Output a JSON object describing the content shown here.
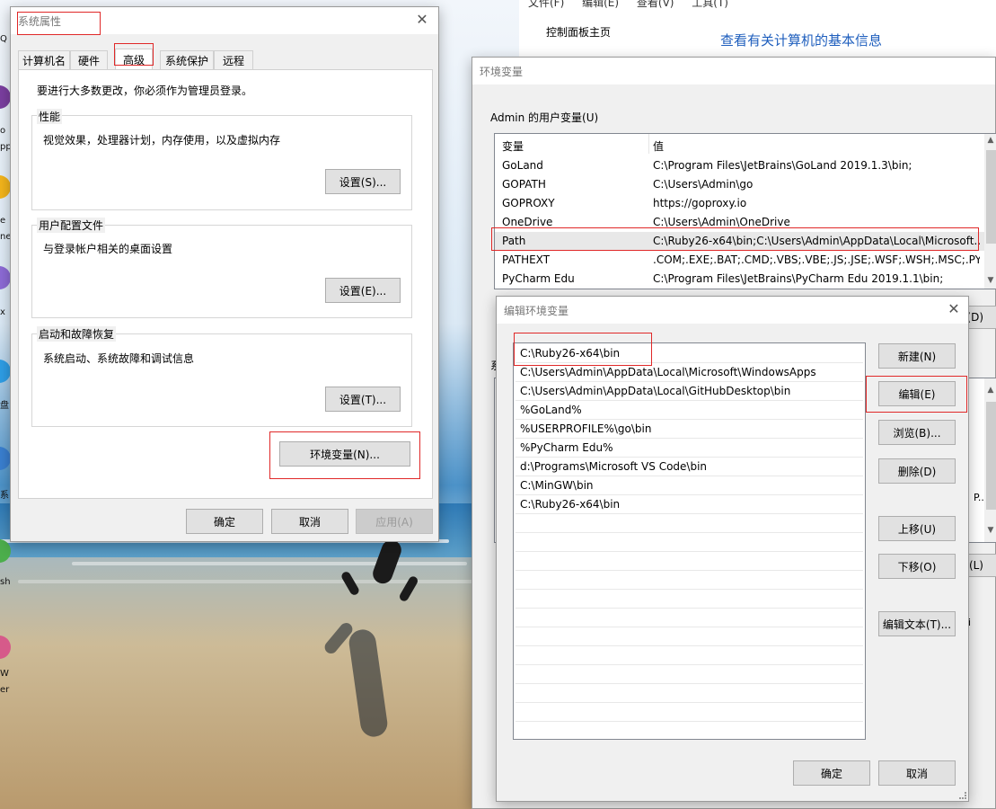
{
  "sysinfo_window": {
    "menu": [
      "文件(F)",
      "编辑(E)",
      "查看(V)",
      "工具(T)"
    ],
    "nav_link": "控制面板主页",
    "heading": "查看有关计算机的基本信息"
  },
  "desktop": {
    "icon_labels": [
      "Q",
      "o",
      "pp",
      "e",
      "ne",
      "x",
      "盘",
      "系",
      "sh",
      "W",
      "er"
    ]
  },
  "system_properties": {
    "title": "系统属性",
    "tabs": [
      "计算机名",
      "硬件",
      "高级",
      "系统保护",
      "远程"
    ],
    "active_tab": "高级",
    "admin_note": "要进行大多数更改，你必须作为管理员登录。",
    "performance": {
      "label": "性能",
      "desc": "视觉效果，处理器计划，内存使用，以及虚拟内存",
      "button": "设置(S)..."
    },
    "user_profiles": {
      "label": "用户配置文件",
      "desc": "与登录帐户相关的桌面设置",
      "button": "设置(E)..."
    },
    "startup": {
      "label": "启动和故障恢复",
      "desc": "系统启动、系统故障和调试信息",
      "button": "设置(T)..."
    },
    "env_button": "环境变量(N)...",
    "ok": "确定",
    "cancel": "取消",
    "apply": "应用(A)"
  },
  "env_vars_window": {
    "title": "环境变量",
    "user_vars_label": "Admin 的用户变量(U)",
    "columns": [
      "变量",
      "值"
    ],
    "rows": [
      {
        "name": "GoLand",
        "value": "C:\\Program Files\\JetBrains\\GoLand 2019.1.3\\bin;"
      },
      {
        "name": "GOPATH",
        "value": "C:\\Users\\Admin\\go"
      },
      {
        "name": "GOPROXY",
        "value": "https://goproxy.io"
      },
      {
        "name": "OneDrive",
        "value": "C:\\Users\\Admin\\OneDrive"
      },
      {
        "name": "Path",
        "value": "C:\\Ruby26-x64\\bin;C:\\Users\\Admin\\AppData\\Local\\Microsoft..."
      },
      {
        "name": "PATHEXT",
        "value": ".COM;.EXE;.BAT;.CMD;.VBS;.VBE;.JS;.JSE;.WSF;.WSH;.MSC;.PY;.P..."
      },
      {
        "name": "PyCharm Edu",
        "value": "C:\\Program Files\\JetBrains\\PyCharm Edu 2019.1.1\\bin;"
      }
    ],
    "system_vars_label_partial": "系",
    "partial_button_d": "(D)",
    "partial_button_l": "(L)",
    "partial_text_p": "P...",
    "partial_text_i": "i"
  },
  "edit_env_window": {
    "title": "编辑环境变量",
    "paths": [
      "C:\\Ruby26-x64\\bin",
      "C:\\Users\\Admin\\AppData\\Local\\Microsoft\\WindowsApps",
      "C:\\Users\\Admin\\AppData\\Local\\GitHubDesktop\\bin",
      "%GoLand%",
      "%USERPROFILE%\\go\\bin",
      "%PyCharm Edu%",
      "d:\\Programs\\Microsoft VS Code\\bin",
      "C:\\MinGW\\bin",
      "C:\\Ruby26-x64\\bin"
    ],
    "buttons": {
      "new": "新建(N)",
      "edit": "编辑(E)",
      "browse": "浏览(B)...",
      "delete": "删除(D)",
      "move_up": "上移(U)",
      "move_down": "下移(O)",
      "edit_text": "编辑文本(T)..."
    },
    "ok": "确定",
    "cancel": "取消"
  }
}
